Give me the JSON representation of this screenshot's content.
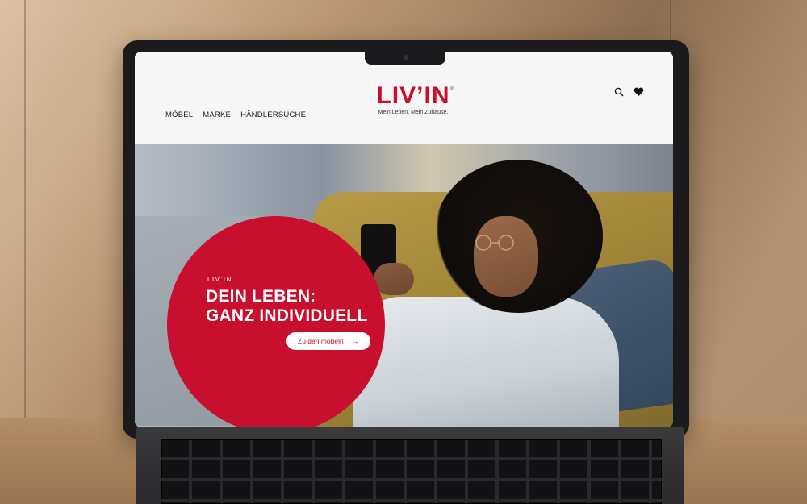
{
  "site": {
    "nav": [
      {
        "label": "MÖBEL"
      },
      {
        "label": "MARKE"
      },
      {
        "label": "HÄNDLERSUCHE"
      }
    ],
    "logo": {
      "wordmark_left": "LIV",
      "apostrophe": "’",
      "wordmark_right": "IN",
      "registered": "®",
      "tagline": "Mein Leben. Mein Zuhause."
    },
    "tools": {
      "search_icon": "search-icon",
      "favorites_icon": "heart-icon"
    }
  },
  "hero": {
    "kicker": "LIV’IN",
    "headline_line1": "DEIN LEBEN:",
    "headline_line2": "GANZ INDIVIDUELL",
    "cta_label": "Zu den möbeln",
    "cta_icon": "arrow-right-icon"
  },
  "colors": {
    "brand_red": "#c8102e",
    "header_bg": "#f6f6f6"
  }
}
